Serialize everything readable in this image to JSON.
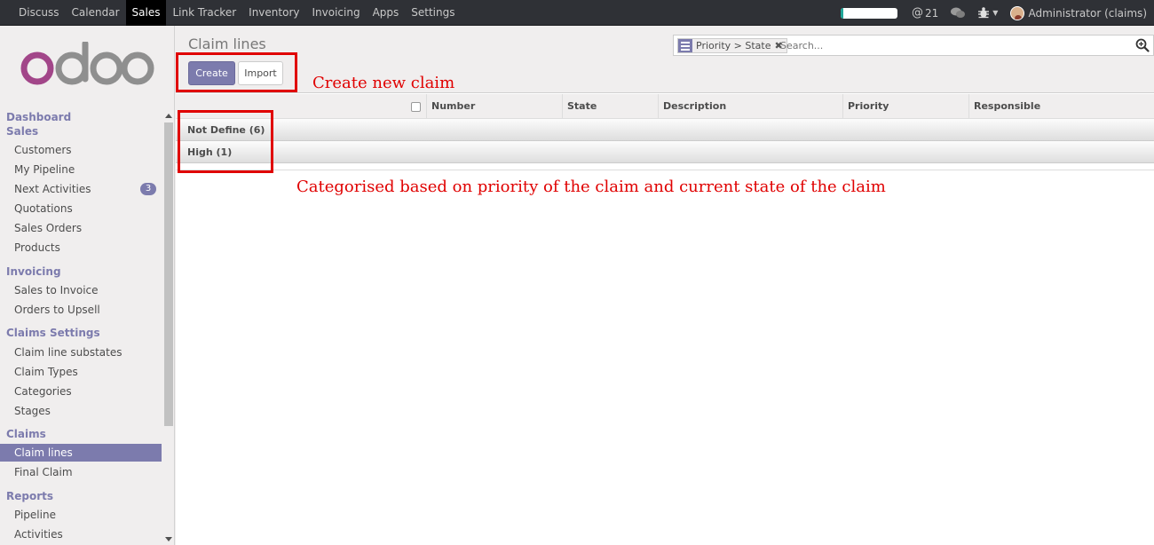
{
  "topbar": {
    "menu": [
      "Discuss",
      "Calendar",
      "Sales",
      "Link Tracker",
      "Inventory",
      "Invoicing",
      "Apps",
      "Settings"
    ],
    "active_menu": "Sales",
    "progress_fraction": 0.05,
    "mentions_count": "21",
    "user": "Administrator (claims)"
  },
  "sidebar": {
    "logo_text": "odoo",
    "dashboard": "Dashboard",
    "sales": {
      "title": "Sales",
      "items": [
        "Customers",
        "My Pipeline",
        "Next Activities",
        "Quotations",
        "Sales Orders",
        "Products"
      ],
      "badge": "3"
    },
    "invoicing": {
      "title": "Invoicing",
      "items": [
        "Sales to Invoice",
        "Orders to Upsell"
      ]
    },
    "claims_settings": {
      "title": "Claims Settings",
      "items": [
        "Claim line substates",
        "Claim Types",
        "Categories",
        "Stages"
      ]
    },
    "claims": {
      "title": "Claims",
      "items": [
        "Claim lines",
        "Final Claim"
      ]
    },
    "reports": {
      "title": "Reports",
      "items": [
        "Pipeline",
        "Activities"
      ]
    }
  },
  "control_panel": {
    "title": "Claim lines",
    "create_label": "Create",
    "import_label": "Import",
    "search_facet": "Priority > State",
    "search_placeholder": "Search..."
  },
  "list": {
    "columns": [
      "Number",
      "State",
      "Description",
      "Priority",
      "Responsible"
    ],
    "groups": [
      "Not Define (6)",
      "High (1)"
    ]
  },
  "annotations": {
    "create": "Create new claim",
    "groups": "Categorised based on priority of the claim and current state of the claim"
  },
  "colors": {
    "brand": "#7c7bad",
    "annotation": "#e00000",
    "navbar": "#2f3136"
  }
}
